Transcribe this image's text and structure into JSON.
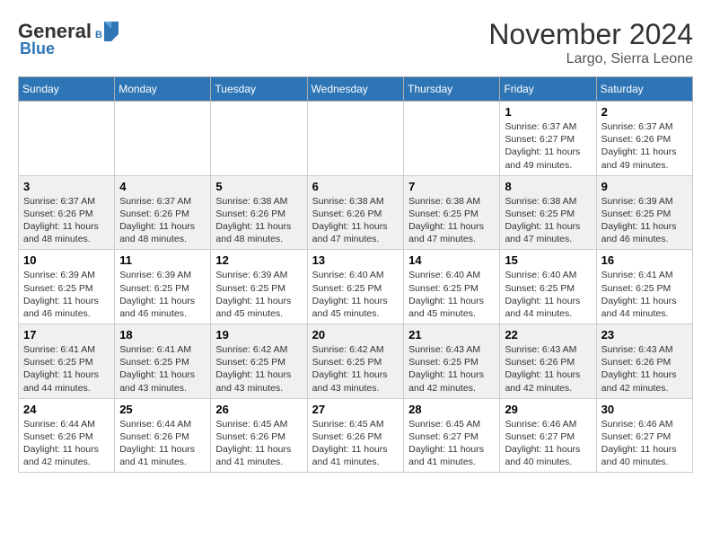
{
  "header": {
    "logo_general": "General",
    "logo_blue": "Blue",
    "month_title": "November 2024",
    "location": "Largo, Sierra Leone"
  },
  "weekdays": [
    "Sunday",
    "Monday",
    "Tuesday",
    "Wednesday",
    "Thursday",
    "Friday",
    "Saturday"
  ],
  "weeks": [
    [
      {
        "day": "",
        "info": ""
      },
      {
        "day": "",
        "info": ""
      },
      {
        "day": "",
        "info": ""
      },
      {
        "day": "",
        "info": ""
      },
      {
        "day": "",
        "info": ""
      },
      {
        "day": "1",
        "info": "Sunrise: 6:37 AM\nSunset: 6:27 PM\nDaylight: 11 hours and 49 minutes."
      },
      {
        "day": "2",
        "info": "Sunrise: 6:37 AM\nSunset: 6:26 PM\nDaylight: 11 hours and 49 minutes."
      }
    ],
    [
      {
        "day": "3",
        "info": "Sunrise: 6:37 AM\nSunset: 6:26 PM\nDaylight: 11 hours and 48 minutes."
      },
      {
        "day": "4",
        "info": "Sunrise: 6:37 AM\nSunset: 6:26 PM\nDaylight: 11 hours and 48 minutes."
      },
      {
        "day": "5",
        "info": "Sunrise: 6:38 AM\nSunset: 6:26 PM\nDaylight: 11 hours and 48 minutes."
      },
      {
        "day": "6",
        "info": "Sunrise: 6:38 AM\nSunset: 6:26 PM\nDaylight: 11 hours and 47 minutes."
      },
      {
        "day": "7",
        "info": "Sunrise: 6:38 AM\nSunset: 6:25 PM\nDaylight: 11 hours and 47 minutes."
      },
      {
        "day": "8",
        "info": "Sunrise: 6:38 AM\nSunset: 6:25 PM\nDaylight: 11 hours and 47 minutes."
      },
      {
        "day": "9",
        "info": "Sunrise: 6:39 AM\nSunset: 6:25 PM\nDaylight: 11 hours and 46 minutes."
      }
    ],
    [
      {
        "day": "10",
        "info": "Sunrise: 6:39 AM\nSunset: 6:25 PM\nDaylight: 11 hours and 46 minutes."
      },
      {
        "day": "11",
        "info": "Sunrise: 6:39 AM\nSunset: 6:25 PM\nDaylight: 11 hours and 46 minutes."
      },
      {
        "day": "12",
        "info": "Sunrise: 6:39 AM\nSunset: 6:25 PM\nDaylight: 11 hours and 45 minutes."
      },
      {
        "day": "13",
        "info": "Sunrise: 6:40 AM\nSunset: 6:25 PM\nDaylight: 11 hours and 45 minutes."
      },
      {
        "day": "14",
        "info": "Sunrise: 6:40 AM\nSunset: 6:25 PM\nDaylight: 11 hours and 45 minutes."
      },
      {
        "day": "15",
        "info": "Sunrise: 6:40 AM\nSunset: 6:25 PM\nDaylight: 11 hours and 44 minutes."
      },
      {
        "day": "16",
        "info": "Sunrise: 6:41 AM\nSunset: 6:25 PM\nDaylight: 11 hours and 44 minutes."
      }
    ],
    [
      {
        "day": "17",
        "info": "Sunrise: 6:41 AM\nSunset: 6:25 PM\nDaylight: 11 hours and 44 minutes."
      },
      {
        "day": "18",
        "info": "Sunrise: 6:41 AM\nSunset: 6:25 PM\nDaylight: 11 hours and 43 minutes."
      },
      {
        "day": "19",
        "info": "Sunrise: 6:42 AM\nSunset: 6:25 PM\nDaylight: 11 hours and 43 minutes."
      },
      {
        "day": "20",
        "info": "Sunrise: 6:42 AM\nSunset: 6:25 PM\nDaylight: 11 hours and 43 minutes."
      },
      {
        "day": "21",
        "info": "Sunrise: 6:43 AM\nSunset: 6:25 PM\nDaylight: 11 hours and 42 minutes."
      },
      {
        "day": "22",
        "info": "Sunrise: 6:43 AM\nSunset: 6:26 PM\nDaylight: 11 hours and 42 minutes."
      },
      {
        "day": "23",
        "info": "Sunrise: 6:43 AM\nSunset: 6:26 PM\nDaylight: 11 hours and 42 minutes."
      }
    ],
    [
      {
        "day": "24",
        "info": "Sunrise: 6:44 AM\nSunset: 6:26 PM\nDaylight: 11 hours and 42 minutes."
      },
      {
        "day": "25",
        "info": "Sunrise: 6:44 AM\nSunset: 6:26 PM\nDaylight: 11 hours and 41 minutes."
      },
      {
        "day": "26",
        "info": "Sunrise: 6:45 AM\nSunset: 6:26 PM\nDaylight: 11 hours and 41 minutes."
      },
      {
        "day": "27",
        "info": "Sunrise: 6:45 AM\nSunset: 6:26 PM\nDaylight: 11 hours and 41 minutes."
      },
      {
        "day": "28",
        "info": "Sunrise: 6:45 AM\nSunset: 6:27 PM\nDaylight: 11 hours and 41 minutes."
      },
      {
        "day": "29",
        "info": "Sunrise: 6:46 AM\nSunset: 6:27 PM\nDaylight: 11 hours and 40 minutes."
      },
      {
        "day": "30",
        "info": "Sunrise: 6:46 AM\nSunset: 6:27 PM\nDaylight: 11 hours and 40 minutes."
      }
    ]
  ]
}
